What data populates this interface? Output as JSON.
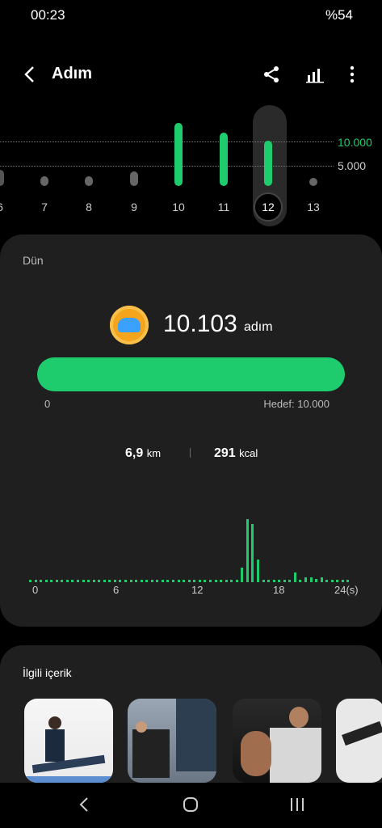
{
  "status": {
    "time": "00:23",
    "battery": "%54"
  },
  "appbar": {
    "title": "Adım"
  },
  "week_chart": {
    "ref_high": "10.000",
    "ref_low": "5.000",
    "days": [
      "6",
      "7",
      "8",
      "9",
      "10",
      "11",
      "12",
      "13"
    ],
    "selected_day": "12"
  },
  "summary": {
    "day_label": "Dün",
    "steps": "10.103",
    "steps_unit": "adım",
    "progress_start": "0",
    "goal": "Hedef: 10.000",
    "distance": "6,9",
    "distance_unit": "km",
    "calories": "291",
    "calories_unit": "kcal",
    "progress_fraction": 1.0
  },
  "hourly_chart": {
    "ticks": [
      "0",
      "6",
      "12",
      "18",
      "24(s)"
    ]
  },
  "related": {
    "title": "İlgili içerik"
  }
}
